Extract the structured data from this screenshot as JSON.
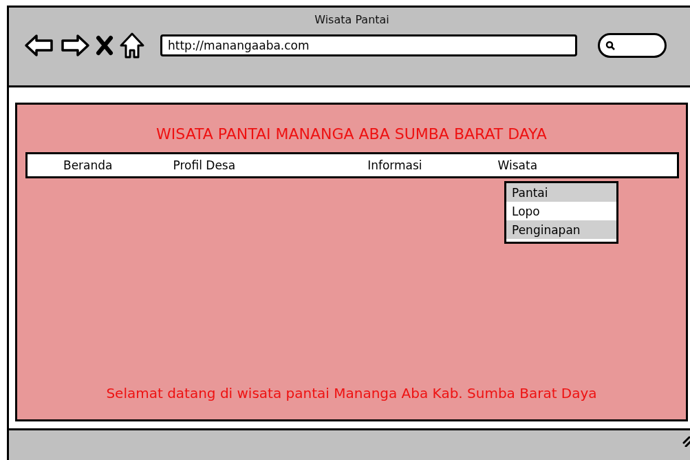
{
  "window": {
    "title": "Wisata Pantai"
  },
  "toolbar": {
    "url": "http://manangaaba.com"
  },
  "page": {
    "heading": "WISATA PANTAI MANANGA ABA SUMBA BARAT DAYA",
    "nav": [
      {
        "label": "Beranda"
      },
      {
        "label": "Profil Desa"
      },
      {
        "label": "Informasi"
      },
      {
        "label": "Wisata"
      }
    ],
    "dropdown": [
      {
        "label": "Pantai",
        "selected": false
      },
      {
        "label": "Lopo",
        "selected": true
      },
      {
        "label": "Penginapan",
        "selected": false
      }
    ],
    "welcome": "Selamat datang di wisata pantai Mananga Aba Kab. Sumba Barat Daya"
  }
}
